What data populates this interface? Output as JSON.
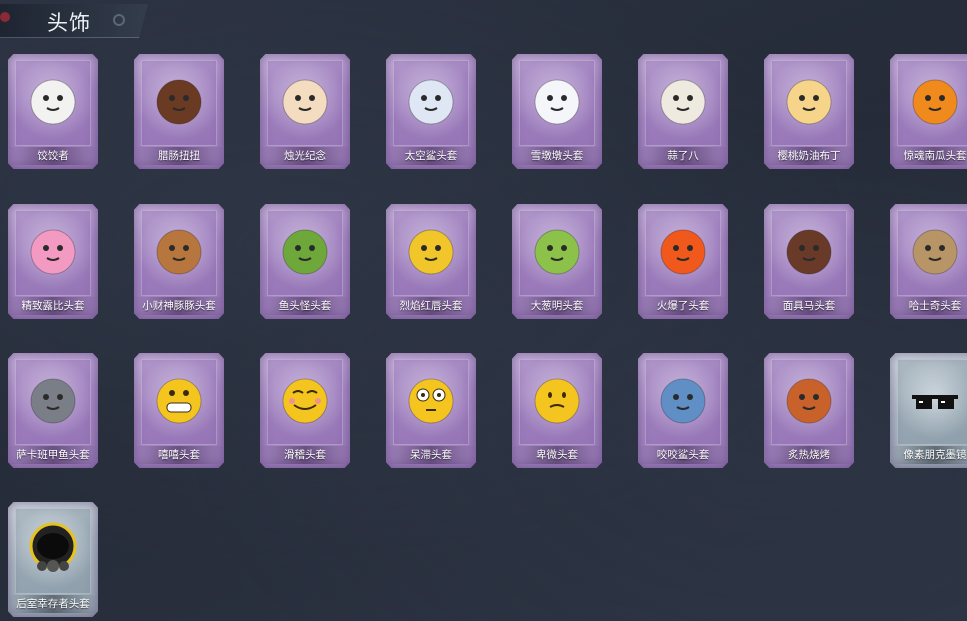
{
  "header": {
    "title": "头饰"
  },
  "items": [
    {
      "label": "饺饺者",
      "icon": "dumpling-head-icon",
      "tier": "purple",
      "color": "#f2f2f0"
    },
    {
      "label": "腊肠扭扭",
      "icon": "sausage-dog-head-icon",
      "tier": "purple",
      "color": "#6b3a22"
    },
    {
      "label": "烛光纪念",
      "icon": "candle-head-icon",
      "tier": "purple",
      "color": "#f3dcc0"
    },
    {
      "label": "太空鲨头套",
      "icon": "space-shark-head-icon",
      "tier": "purple",
      "color": "#dfe7f5"
    },
    {
      "label": "雪墩墩头套",
      "icon": "snowman-head-icon",
      "tier": "purple",
      "color": "#f4f6fa"
    },
    {
      "label": "蒜了八",
      "icon": "garlic-head-icon",
      "tier": "purple",
      "color": "#efeadf"
    },
    {
      "label": "樱桃奶油布丁",
      "icon": "pudding-head-icon",
      "tier": "purple",
      "color": "#f6d58a"
    },
    {
      "label": "惊魂南瓜头套",
      "icon": "pumpkin-head-icon",
      "tier": "purple",
      "color": "#f08a1c"
    },
    {
      "label": "精致露比头套",
      "icon": "pink-pig-head-icon",
      "tier": "purple",
      "color": "#f29ac2"
    },
    {
      "label": "小财神豚豚头套",
      "icon": "fortune-pig-head-icon",
      "tier": "purple",
      "color": "#b8763f"
    },
    {
      "label": "鱼头怪头套",
      "icon": "fish-monster-head-icon",
      "tier": "purple",
      "color": "#6fa83a"
    },
    {
      "label": "烈焰红唇头套",
      "icon": "yellow-mouse-head-icon",
      "tier": "purple",
      "color": "#f1c62a"
    },
    {
      "label": "大葱明头套",
      "icon": "scallion-head-icon",
      "tier": "purple",
      "color": "#8cc24a"
    },
    {
      "label": "火爆了头套",
      "icon": "fire-head-icon",
      "tier": "purple",
      "color": "#f0581c"
    },
    {
      "label": "面具马头套",
      "icon": "horse-mask-icon",
      "tier": "purple",
      "color": "#6a3a28"
    },
    {
      "label": "哈士奇头套",
      "icon": "husky-head-icon",
      "tier": "purple",
      "color": "#b89566"
    },
    {
      "label": "萨卡班甲鱼头套",
      "icon": "sacabambaspis-head-icon",
      "tier": "purple",
      "color": "#7a7e86"
    },
    {
      "label": "嘻嘻头套",
      "icon": "grin-emoji-icon",
      "tier": "purple",
      "color": "#f5c51f"
    },
    {
      "label": "滑稽头套",
      "icon": "smirk-emoji-icon",
      "tier": "purple",
      "color": "#f5c51f"
    },
    {
      "label": "呆滞头套",
      "icon": "dazed-emoji-icon",
      "tier": "purple",
      "color": "#f5c51f"
    },
    {
      "label": "卑微头套",
      "icon": "humble-emoji-icon",
      "tier": "purple",
      "color": "#f5c51f"
    },
    {
      "label": "咬咬鲨头套",
      "icon": "biting-shark-head-icon",
      "tier": "purple",
      "color": "#5f8fc4"
    },
    {
      "label": "炙热烧烤",
      "icon": "barbecue-head-icon",
      "tier": "purple",
      "color": "#c8622a"
    },
    {
      "label": "像素朋克墨镜",
      "icon": "pixel-sunglasses-icon",
      "tier": "silver",
      "color": "#111111"
    },
    {
      "label": "后室幸存者头套",
      "icon": "gas-mask-helmet-icon",
      "tier": "silver",
      "color": "#2a2a2a"
    }
  ]
}
